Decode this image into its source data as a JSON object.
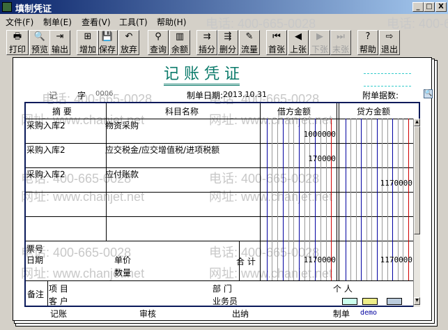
{
  "window": {
    "title": "填制凭证",
    "min": "_",
    "max": "□",
    "close": "X"
  },
  "menu": [
    "文件(F)",
    "制单(E)",
    "查看(V)",
    "工具(T)",
    "帮助(H)"
  ],
  "toolbar": [
    {
      "label": "打印",
      "icon": "printer-icon",
      "glyph": "🖶",
      "enabled": true
    },
    {
      "label": "预览",
      "icon": "preview-icon",
      "glyph": "🔍",
      "enabled": true
    },
    {
      "label": "输出",
      "icon": "export-icon",
      "glyph": "⇥",
      "enabled": true
    },
    {
      "label": "增加",
      "icon": "add-icon",
      "glyph": "⊞",
      "enabled": true
    },
    {
      "label": "保存",
      "icon": "save-icon",
      "glyph": "💾",
      "enabled": true
    },
    {
      "label": "放弃",
      "icon": "undo-icon",
      "glyph": "↶",
      "enabled": true
    },
    {
      "label": "查询",
      "icon": "binoculars-icon",
      "glyph": "⚲",
      "enabled": true
    },
    {
      "label": "余额",
      "icon": "chart-icon",
      "glyph": "▥",
      "enabled": true
    },
    {
      "label": "插分",
      "icon": "insert-row-icon",
      "glyph": "⇉",
      "enabled": true
    },
    {
      "label": "删分",
      "icon": "delete-row-icon",
      "glyph": "⇶",
      "enabled": true
    },
    {
      "label": "流量",
      "icon": "edit-icon",
      "glyph": "✎",
      "enabled": true
    },
    {
      "label": "首张",
      "icon": "first-icon",
      "glyph": "⏮",
      "enabled": true
    },
    {
      "label": "上张",
      "icon": "prev-icon",
      "glyph": "◀",
      "enabled": true
    },
    {
      "label": "下张",
      "icon": "next-icon",
      "glyph": "▶",
      "enabled": false
    },
    {
      "label": "末张",
      "icon": "last-icon",
      "glyph": "⏭",
      "enabled": false
    },
    {
      "label": "帮助",
      "icon": "help-icon",
      "glyph": "?",
      "enabled": true
    },
    {
      "label": "退出",
      "icon": "exit-icon",
      "glyph": "⇨",
      "enabled": true
    }
  ],
  "voucher": {
    "title": "记 账 凭 证",
    "type": "记",
    "zi": "字",
    "number": "0006",
    "date_label": "制单日期:",
    "date": "2013.10.31",
    "attach_label": "附单据数:",
    "headers": {
      "summary": "摘 要",
      "account": "科目名称",
      "debit": "借方金额",
      "credit": "贷方金额"
    },
    "rows": [
      {
        "summary": "采购入库2",
        "account": "物资采购",
        "debit": "1000000",
        "credit": ""
      },
      {
        "summary": "采购入库2",
        "account": "应交税金/应交增值税/进项税额",
        "debit": "170000",
        "credit": ""
      },
      {
        "summary": "采购入库2",
        "account": "应付账款",
        "debit": "",
        "credit": "1170000"
      },
      {
        "summary": "",
        "account": "",
        "debit": "",
        "credit": ""
      },
      {
        "summary": "",
        "account": "",
        "debit": "",
        "credit": ""
      }
    ],
    "ticket_label": "票号",
    "date2_label": "日期",
    "price_label": "单价",
    "qty_label": "数量",
    "total_label": "合 计",
    "total_debit": "1170000",
    "total_credit": "1170000",
    "remark_label": "备注",
    "project_label": "项 目",
    "dept_label": "部 门",
    "person_label": "个 人",
    "customer_label": "客 户",
    "salesman_label": "业务员",
    "footer": {
      "bookkeeping": "记账",
      "audit": "审核",
      "cashier": "出纳",
      "maker_label": "制单",
      "maker": "demo"
    }
  },
  "watermark": {
    "phone": "电话: 400-665-0028",
    "site": "网址: www.chanjet.net"
  },
  "colors": {
    "title": "#0a7a6a",
    "frame": "#0a1a5a",
    "blue_line": "#0000a0",
    "red_line": "#d00000"
  }
}
